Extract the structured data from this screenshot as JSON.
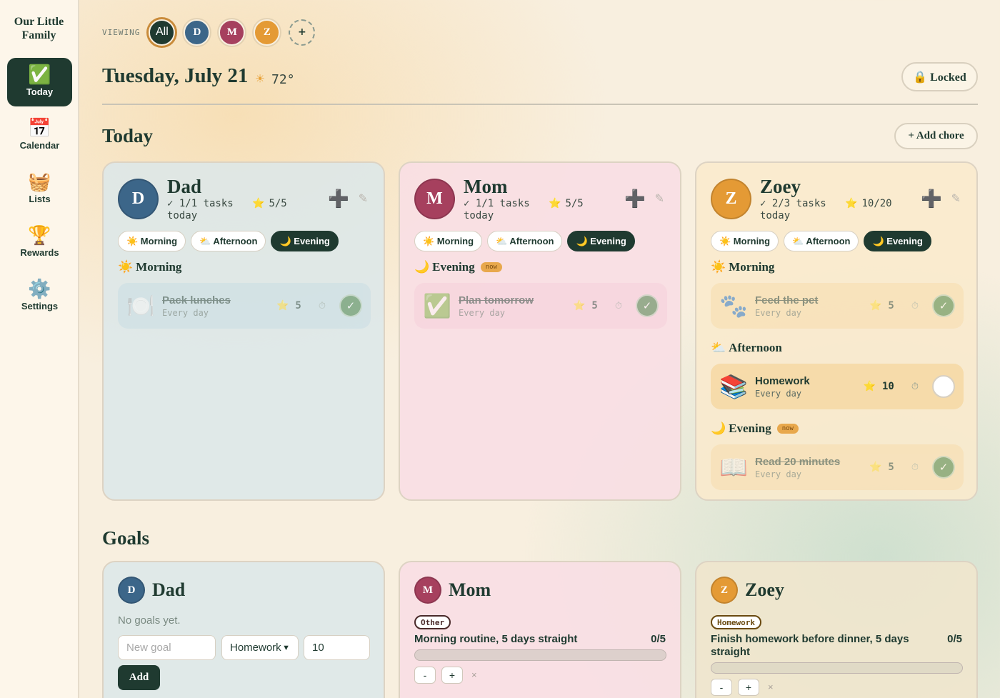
{
  "app": {
    "name": "Our Little Family"
  },
  "nav": [
    {
      "icon": "✅",
      "label": "Today",
      "active": true
    },
    {
      "icon": "📅",
      "label": "Calendar"
    },
    {
      "icon": "🧺",
      "label": "Lists"
    },
    {
      "icon": "🏆",
      "label": "Rewards"
    },
    {
      "icon": "⚙️",
      "label": "Settings"
    }
  ],
  "viewing": {
    "label": "VIEWING",
    "pills": [
      "All",
      "D",
      "M",
      "Z",
      "+"
    ]
  },
  "header": {
    "date": "Tuesday, July 21",
    "weather_icon": "☀",
    "temp": "72°",
    "lock_label": "🔒 Locked"
  },
  "today": {
    "title": "Today",
    "add_chore": "+ Add chore"
  },
  "tabs": {
    "morning": "☀️ Morning",
    "afternoon": "⛅ Afternoon",
    "evening": "🌙 Evening",
    "active": "Evening"
  },
  "members": [
    {
      "name": "Dad",
      "initial": "D",
      "color": "#3c6689",
      "tasks": "✓ 1/1 tasks today",
      "stars": "5/5",
      "groups": [
        {
          "icon": "☀️",
          "label": "Morning",
          "now": "",
          "chores": [
            {
              "emoji": "🍽️",
              "name": "Pack lunches",
              "freq": "Every day",
              "points": "5",
              "done": true
            }
          ]
        }
      ]
    },
    {
      "name": "Mom",
      "initial": "M",
      "color": "#a6405e",
      "tasks": "✓ 1/1 tasks today",
      "stars": "5/5",
      "groups": [
        {
          "icon": "🌙",
          "label": "Evening",
          "now": "now",
          "chores": [
            {
              "emoji": "✅",
              "name": "Plan tomorrow",
              "freq": "Every day",
              "points": "5",
              "done": true
            }
          ]
        }
      ]
    },
    {
      "name": "Zoey",
      "initial": "Z",
      "color": "#e49a35",
      "tasks": "✓ 2/3 tasks today",
      "stars": "10/20",
      "groups": [
        {
          "icon": "☀️",
          "label": "Morning",
          "now": "",
          "chores": [
            {
              "emoji": "🐾",
              "name": "Feed the pet",
              "freq": "Every day",
              "points": "5",
              "done": true
            }
          ]
        },
        {
          "icon": "⛅",
          "label": "Afternoon",
          "now": "",
          "chores": [
            {
              "emoji": "📚",
              "name": "Homework",
              "freq": "Every day",
              "points": "10",
              "done": false
            }
          ]
        },
        {
          "icon": "🌙",
          "label": "Evening",
          "now": "now",
          "chores": [
            {
              "emoji": "📖",
              "name": "Read 20 minutes",
              "freq": "Every day",
              "points": "5",
              "done": true
            }
          ]
        }
      ]
    }
  ],
  "goals": {
    "title": "Goals",
    "dad": {
      "name": "Dad",
      "initial": "D",
      "empty": "No goals yet.",
      "new_goal_placeholder": "New goal",
      "category": "Homework",
      "target": "10",
      "add": "Add"
    },
    "mom": {
      "name": "Mom",
      "initial": "M",
      "tag": "Other",
      "title": "Morning routine, 5 days straight",
      "count": "0/5",
      "progress": 0,
      "minus": "-",
      "plus": "+",
      "remove": "×"
    },
    "zoey": {
      "name": "Zoey",
      "initial": "Z",
      "tag": "Homework",
      "title": "Finish homework before dinner, 5 days straight",
      "count": "0/5",
      "progress": 0,
      "minus": "-",
      "plus": "+",
      "remove": "×"
    }
  },
  "icons": {
    "check": "✓",
    "timer": "⏱",
    "star": "⭐",
    "add": "➕",
    "edit": "✎"
  }
}
